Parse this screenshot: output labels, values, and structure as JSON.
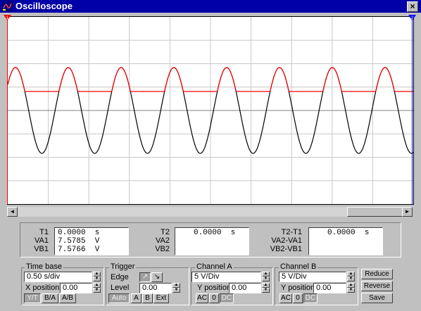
{
  "window": {
    "title": "Oscilloscope",
    "close_glyph": "×"
  },
  "cursor_markers": {
    "t1": "1",
    "t2": "2"
  },
  "scroll": {
    "left": "◄",
    "right": "►"
  },
  "readout": {
    "col1": {
      "labels": [
        "T1",
        "VA1",
        "VB1"
      ],
      "values": [
        "0.0000  s",
        "7.5785  V",
        "7.5766  V"
      ]
    },
    "col2": {
      "labels": [
        "T2",
        "VA2",
        "VB2"
      ],
      "values": [
        "0.0000  s",
        "",
        ""
      ]
    },
    "col3": {
      "labels": [
        "T2-T1",
        "VA2-VA1",
        "VB2-VB1"
      ],
      "values": [
        "0.0000  s",
        "",
        ""
      ]
    }
  },
  "timebase": {
    "title": "Time base",
    "value": "0.50 s/div",
    "xpos_label": "X position",
    "xpos_value": "0.00",
    "buttons": [
      "Y/T",
      "B/A",
      "A/B"
    ]
  },
  "trigger": {
    "title": "Trigger",
    "edge_label": "Edge",
    "edge_rise": "↗",
    "edge_fall": "↘",
    "level_label": "Level",
    "level_value": "0.00",
    "buttons": [
      "Auto",
      "A",
      "B",
      "Ext"
    ]
  },
  "channel_a": {
    "title": "Channel A",
    "value": "5 V/Div",
    "ypos_label": "Y position",
    "ypos_value": "0.00",
    "buttons": [
      "AC",
      "0",
      "DC"
    ]
  },
  "channel_b": {
    "title": "Channel B",
    "value": "5 V/Div",
    "ypos_label": "Y position",
    "ypos_value": "0.00",
    "buttons": [
      "AC",
      "0",
      "DC"
    ]
  },
  "actions": {
    "reduce": "Reduce",
    "reverse": "Reverse",
    "save": "Save"
  },
  "colors": {
    "channel_a": "#000000",
    "channel_b": "#ff0000",
    "grid": "#c8c8c8",
    "axis": "#808080"
  }
}
